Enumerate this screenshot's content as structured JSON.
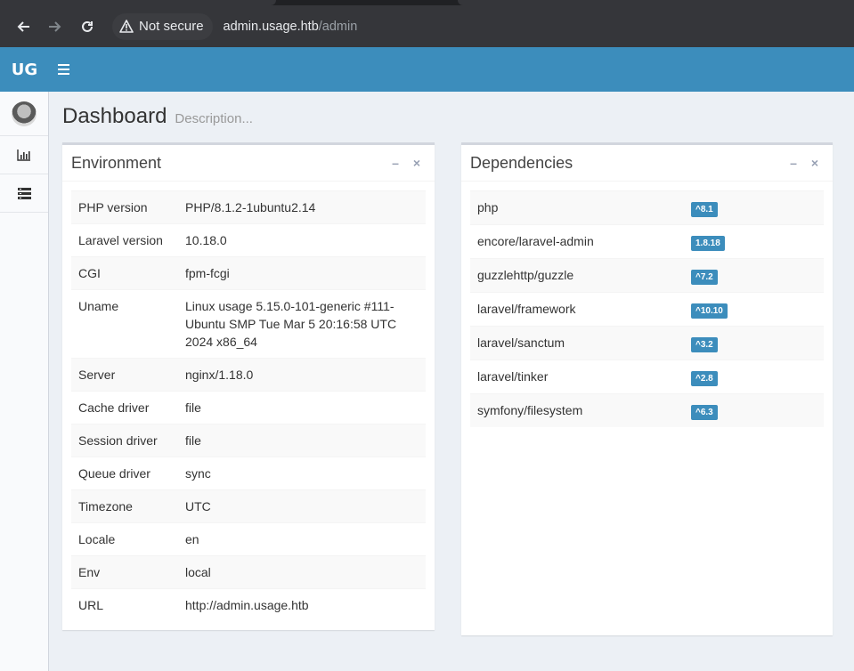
{
  "browser": {
    "security_text": "Not secure",
    "url_host": "admin.usage.htb",
    "url_path": "/admin"
  },
  "app": {
    "logo": "UG"
  },
  "page": {
    "title": "Dashboard",
    "description": "Description..."
  },
  "environment": {
    "title": "Environment",
    "rows": [
      {
        "key": "PHP version",
        "value": "PHP/8.1.2-1ubuntu2.14"
      },
      {
        "key": "Laravel version",
        "value": "10.18.0"
      },
      {
        "key": "CGI",
        "value": "fpm-fcgi"
      },
      {
        "key": "Uname",
        "value": "Linux usage 5.15.0-101-generic #111-Ubuntu SMP Tue Mar 5 20:16:58 UTC 2024 x86_64"
      },
      {
        "key": "Server",
        "value": "nginx/1.18.0"
      },
      {
        "key": "Cache driver",
        "value": "file"
      },
      {
        "key": "Session driver",
        "value": "file"
      },
      {
        "key": "Queue driver",
        "value": "sync"
      },
      {
        "key": "Timezone",
        "value": "UTC"
      },
      {
        "key": "Locale",
        "value": "en"
      },
      {
        "key": "Env",
        "value": "local"
      },
      {
        "key": "URL",
        "value": "http://admin.usage.htb"
      }
    ]
  },
  "dependencies": {
    "title": "Dependencies",
    "rows": [
      {
        "name": "php",
        "version": "^8.1"
      },
      {
        "name": "encore/laravel-admin",
        "version": "1.8.18"
      },
      {
        "name": "guzzlehttp/guzzle",
        "version": "^7.2"
      },
      {
        "name": "laravel/framework",
        "version": "^10.10"
      },
      {
        "name": "laravel/sanctum",
        "version": "^3.2"
      },
      {
        "name": "laravel/tinker",
        "version": "^2.8"
      },
      {
        "name": "symfony/filesystem",
        "version": "^6.3"
      }
    ]
  },
  "colors": {
    "header": "#3c8dbc",
    "label": "#3c8dbc"
  }
}
